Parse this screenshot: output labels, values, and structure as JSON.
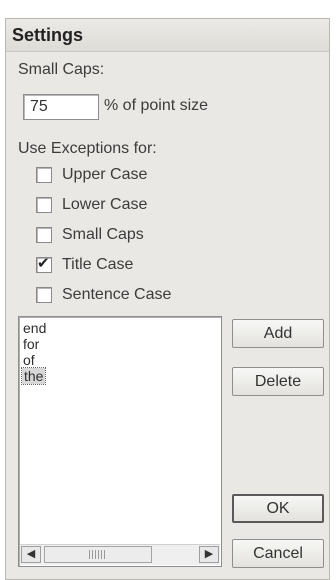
{
  "dialog": {
    "title": "Settings"
  },
  "small_caps": {
    "label": "Small Caps:",
    "value": "75",
    "suffix": "% of point size"
  },
  "exceptions": {
    "label": "Use Exceptions for:",
    "options": [
      {
        "label": "Upper Case",
        "checked": false
      },
      {
        "label": "Lower Case",
        "checked": false
      },
      {
        "label": "Small Caps",
        "checked": false
      },
      {
        "label": "Title Case",
        "checked": true
      },
      {
        "label": "Sentence Case",
        "checked": false
      }
    ]
  },
  "words": {
    "items": [
      "end",
      "for",
      "of",
      "the"
    ],
    "selected_index": 3
  },
  "buttons": {
    "add": "Add",
    "delete": "Delete",
    "ok": "OK",
    "cancel": "Cancel"
  },
  "glyphs": {
    "check": "✔",
    "scroll_left": "◀",
    "scroll_right": "▶"
  }
}
